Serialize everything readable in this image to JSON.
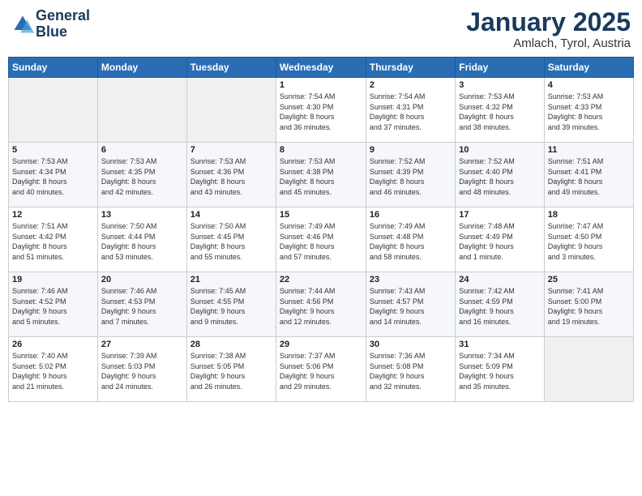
{
  "logo": {
    "line1": "General",
    "line2": "Blue"
  },
  "header": {
    "month": "January 2025",
    "location": "Amlach, Tyrol, Austria"
  },
  "weekdays": [
    "Sunday",
    "Monday",
    "Tuesday",
    "Wednesday",
    "Thursday",
    "Friday",
    "Saturday"
  ],
  "weeks": [
    [
      {
        "day": "",
        "info": ""
      },
      {
        "day": "",
        "info": ""
      },
      {
        "day": "",
        "info": ""
      },
      {
        "day": "1",
        "info": "Sunrise: 7:54 AM\nSunset: 4:30 PM\nDaylight: 8 hours\nand 36 minutes."
      },
      {
        "day": "2",
        "info": "Sunrise: 7:54 AM\nSunset: 4:31 PM\nDaylight: 8 hours\nand 37 minutes."
      },
      {
        "day": "3",
        "info": "Sunrise: 7:53 AM\nSunset: 4:32 PM\nDaylight: 8 hours\nand 38 minutes."
      },
      {
        "day": "4",
        "info": "Sunrise: 7:53 AM\nSunset: 4:33 PM\nDaylight: 8 hours\nand 39 minutes."
      }
    ],
    [
      {
        "day": "5",
        "info": "Sunrise: 7:53 AM\nSunset: 4:34 PM\nDaylight: 8 hours\nand 40 minutes."
      },
      {
        "day": "6",
        "info": "Sunrise: 7:53 AM\nSunset: 4:35 PM\nDaylight: 8 hours\nand 42 minutes."
      },
      {
        "day": "7",
        "info": "Sunrise: 7:53 AM\nSunset: 4:36 PM\nDaylight: 8 hours\nand 43 minutes."
      },
      {
        "day": "8",
        "info": "Sunrise: 7:53 AM\nSunset: 4:38 PM\nDaylight: 8 hours\nand 45 minutes."
      },
      {
        "day": "9",
        "info": "Sunrise: 7:52 AM\nSunset: 4:39 PM\nDaylight: 8 hours\nand 46 minutes."
      },
      {
        "day": "10",
        "info": "Sunrise: 7:52 AM\nSunset: 4:40 PM\nDaylight: 8 hours\nand 48 minutes."
      },
      {
        "day": "11",
        "info": "Sunrise: 7:51 AM\nSunset: 4:41 PM\nDaylight: 8 hours\nand 49 minutes."
      }
    ],
    [
      {
        "day": "12",
        "info": "Sunrise: 7:51 AM\nSunset: 4:42 PM\nDaylight: 8 hours\nand 51 minutes."
      },
      {
        "day": "13",
        "info": "Sunrise: 7:50 AM\nSunset: 4:44 PM\nDaylight: 8 hours\nand 53 minutes."
      },
      {
        "day": "14",
        "info": "Sunrise: 7:50 AM\nSunset: 4:45 PM\nDaylight: 8 hours\nand 55 minutes."
      },
      {
        "day": "15",
        "info": "Sunrise: 7:49 AM\nSunset: 4:46 PM\nDaylight: 8 hours\nand 57 minutes."
      },
      {
        "day": "16",
        "info": "Sunrise: 7:49 AM\nSunset: 4:48 PM\nDaylight: 8 hours\nand 58 minutes."
      },
      {
        "day": "17",
        "info": "Sunrise: 7:48 AM\nSunset: 4:49 PM\nDaylight: 9 hours\nand 1 minute."
      },
      {
        "day": "18",
        "info": "Sunrise: 7:47 AM\nSunset: 4:50 PM\nDaylight: 9 hours\nand 3 minutes."
      }
    ],
    [
      {
        "day": "19",
        "info": "Sunrise: 7:46 AM\nSunset: 4:52 PM\nDaylight: 9 hours\nand 5 minutes."
      },
      {
        "day": "20",
        "info": "Sunrise: 7:46 AM\nSunset: 4:53 PM\nDaylight: 9 hours\nand 7 minutes."
      },
      {
        "day": "21",
        "info": "Sunrise: 7:45 AM\nSunset: 4:55 PM\nDaylight: 9 hours\nand 9 minutes."
      },
      {
        "day": "22",
        "info": "Sunrise: 7:44 AM\nSunset: 4:56 PM\nDaylight: 9 hours\nand 12 minutes."
      },
      {
        "day": "23",
        "info": "Sunrise: 7:43 AM\nSunset: 4:57 PM\nDaylight: 9 hours\nand 14 minutes."
      },
      {
        "day": "24",
        "info": "Sunrise: 7:42 AM\nSunset: 4:59 PM\nDaylight: 9 hours\nand 16 minutes."
      },
      {
        "day": "25",
        "info": "Sunrise: 7:41 AM\nSunset: 5:00 PM\nDaylight: 9 hours\nand 19 minutes."
      }
    ],
    [
      {
        "day": "26",
        "info": "Sunrise: 7:40 AM\nSunset: 5:02 PM\nDaylight: 9 hours\nand 21 minutes."
      },
      {
        "day": "27",
        "info": "Sunrise: 7:39 AM\nSunset: 5:03 PM\nDaylight: 9 hours\nand 24 minutes."
      },
      {
        "day": "28",
        "info": "Sunrise: 7:38 AM\nSunset: 5:05 PM\nDaylight: 9 hours\nand 26 minutes."
      },
      {
        "day": "29",
        "info": "Sunrise: 7:37 AM\nSunset: 5:06 PM\nDaylight: 9 hours\nand 29 minutes."
      },
      {
        "day": "30",
        "info": "Sunrise: 7:36 AM\nSunset: 5:08 PM\nDaylight: 9 hours\nand 32 minutes."
      },
      {
        "day": "31",
        "info": "Sunrise: 7:34 AM\nSunset: 5:09 PM\nDaylight: 9 hours\nand 35 minutes."
      },
      {
        "day": "",
        "info": ""
      }
    ]
  ]
}
